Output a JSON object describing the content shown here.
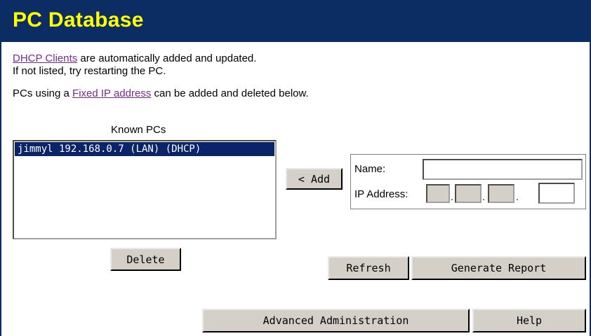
{
  "header": {
    "title": "PC Database"
  },
  "intro": {
    "dhcp_link": "DHCP Clients",
    "line1_rest": " are automatically added and updated.",
    "line2": "If not listed, try restarting the PC.",
    "line3_prefix": "PCs using a ",
    "fixed_link": "Fixed IP address",
    "line3_suffix": " can be added and deleted below."
  },
  "known_pcs": {
    "label": "Known PCs",
    "items": [
      "jimmyl 192.168.0.7 (LAN) (DHCP)"
    ]
  },
  "buttons": {
    "add": "< Add",
    "delete": "Delete",
    "refresh": "Refresh",
    "generate_report": "Generate Report",
    "advanced_admin": "Advanced Administration",
    "help": "Help"
  },
  "form": {
    "name_label": "Name:",
    "name_value": "",
    "ip_label": "IP Address:",
    "ip_octets": [
      "",
      "",
      "",
      ""
    ],
    "ip_separator": "."
  }
}
